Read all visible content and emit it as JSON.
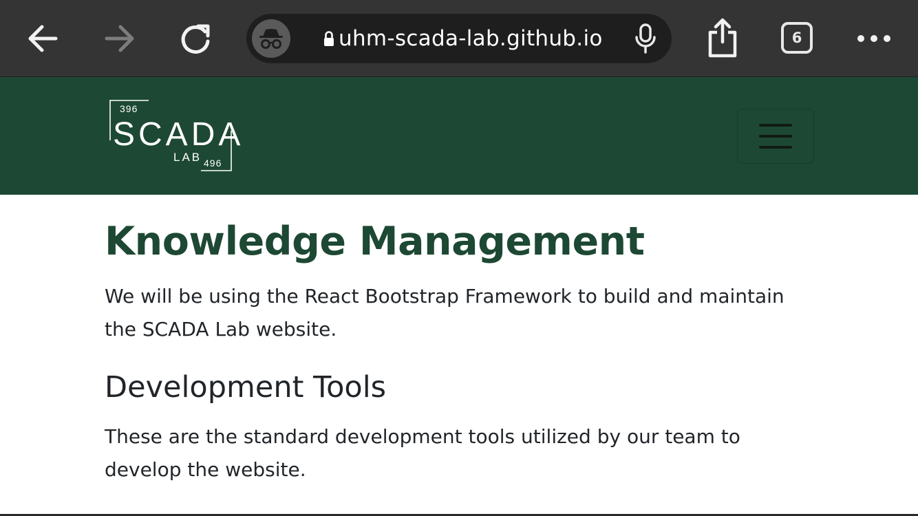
{
  "browser": {
    "url": "uhm-scada-lab.github.io",
    "tab_count": "6",
    "icons": {
      "back": "arrow-left-icon",
      "forward": "arrow-right-icon",
      "reload": "reload-icon",
      "incognito": "incognito-icon",
      "lock": "lock-icon",
      "mic": "microphone-icon",
      "share": "share-icon",
      "tabs": "tabs-icon",
      "more": "more-icon"
    }
  },
  "navbar": {
    "logo": {
      "word": "SCADA",
      "sub": "LAB",
      "num_top": "396",
      "num_bottom": "496"
    },
    "toggle_icon": "hamburger-menu-icon",
    "bg_color": "#1d4834"
  },
  "main": {
    "title": "Knowledge Management",
    "intro": "We will be using the React Bootstrap Framework to build and maintain the SCADA Lab website.",
    "section_title": "Development Tools",
    "section_text": "These are the standard development tools utilized by our team to develop the website."
  }
}
